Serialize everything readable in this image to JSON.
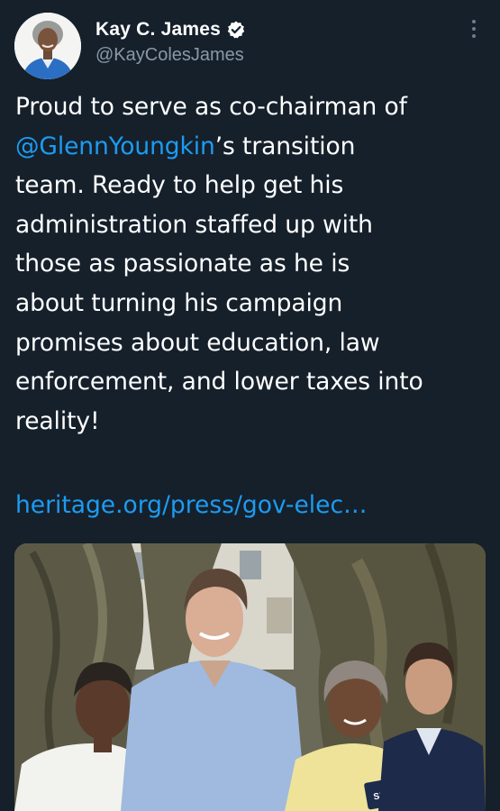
{
  "user": {
    "display_name": "Kay C. James",
    "handle": "@KayColesJames",
    "verified": true,
    "avatar_icon": "profile-photo"
  },
  "tweet": {
    "lines": [
      {
        "parts": [
          {
            "text": "Proud to serve as co-chairman of",
            "type": "text"
          }
        ]
      },
      {
        "parts": [
          {
            "text": "@GlennYoungkin",
            "type": "mention"
          },
          {
            "text": "’s transition",
            "type": "text"
          }
        ]
      },
      {
        "parts": [
          {
            "text": "team. Ready to help get his",
            "type": "text"
          }
        ]
      },
      {
        "parts": [
          {
            "text": "administration staffed up with",
            "type": "text"
          }
        ]
      },
      {
        "parts": [
          {
            "text": "those as passionate as he is",
            "type": "text"
          }
        ]
      },
      {
        "parts": [
          {
            "text": "about turning his campaign",
            "type": "text"
          }
        ]
      },
      {
        "parts": [
          {
            "text": "promises about education, law",
            "type": "text"
          }
        ]
      },
      {
        "parts": [
          {
            "text": "enforcement, and lower taxes into",
            "type": "text"
          }
        ]
      },
      {
        "parts": [
          {
            "text": "reality!",
            "type": "text"
          }
        ]
      }
    ],
    "link": "heritage.org/press/gov-elec…"
  },
  "media": {
    "photo_icon": "group-photo",
    "sign_text": "SEARS"
  },
  "colors": {
    "background": "#15202b",
    "text": "#ffffff",
    "secondary": "#8b98a5",
    "accent": "#1d9bf0"
  },
  "icons": {
    "verified": "verified-badge-icon",
    "more": "more-options-icon"
  }
}
